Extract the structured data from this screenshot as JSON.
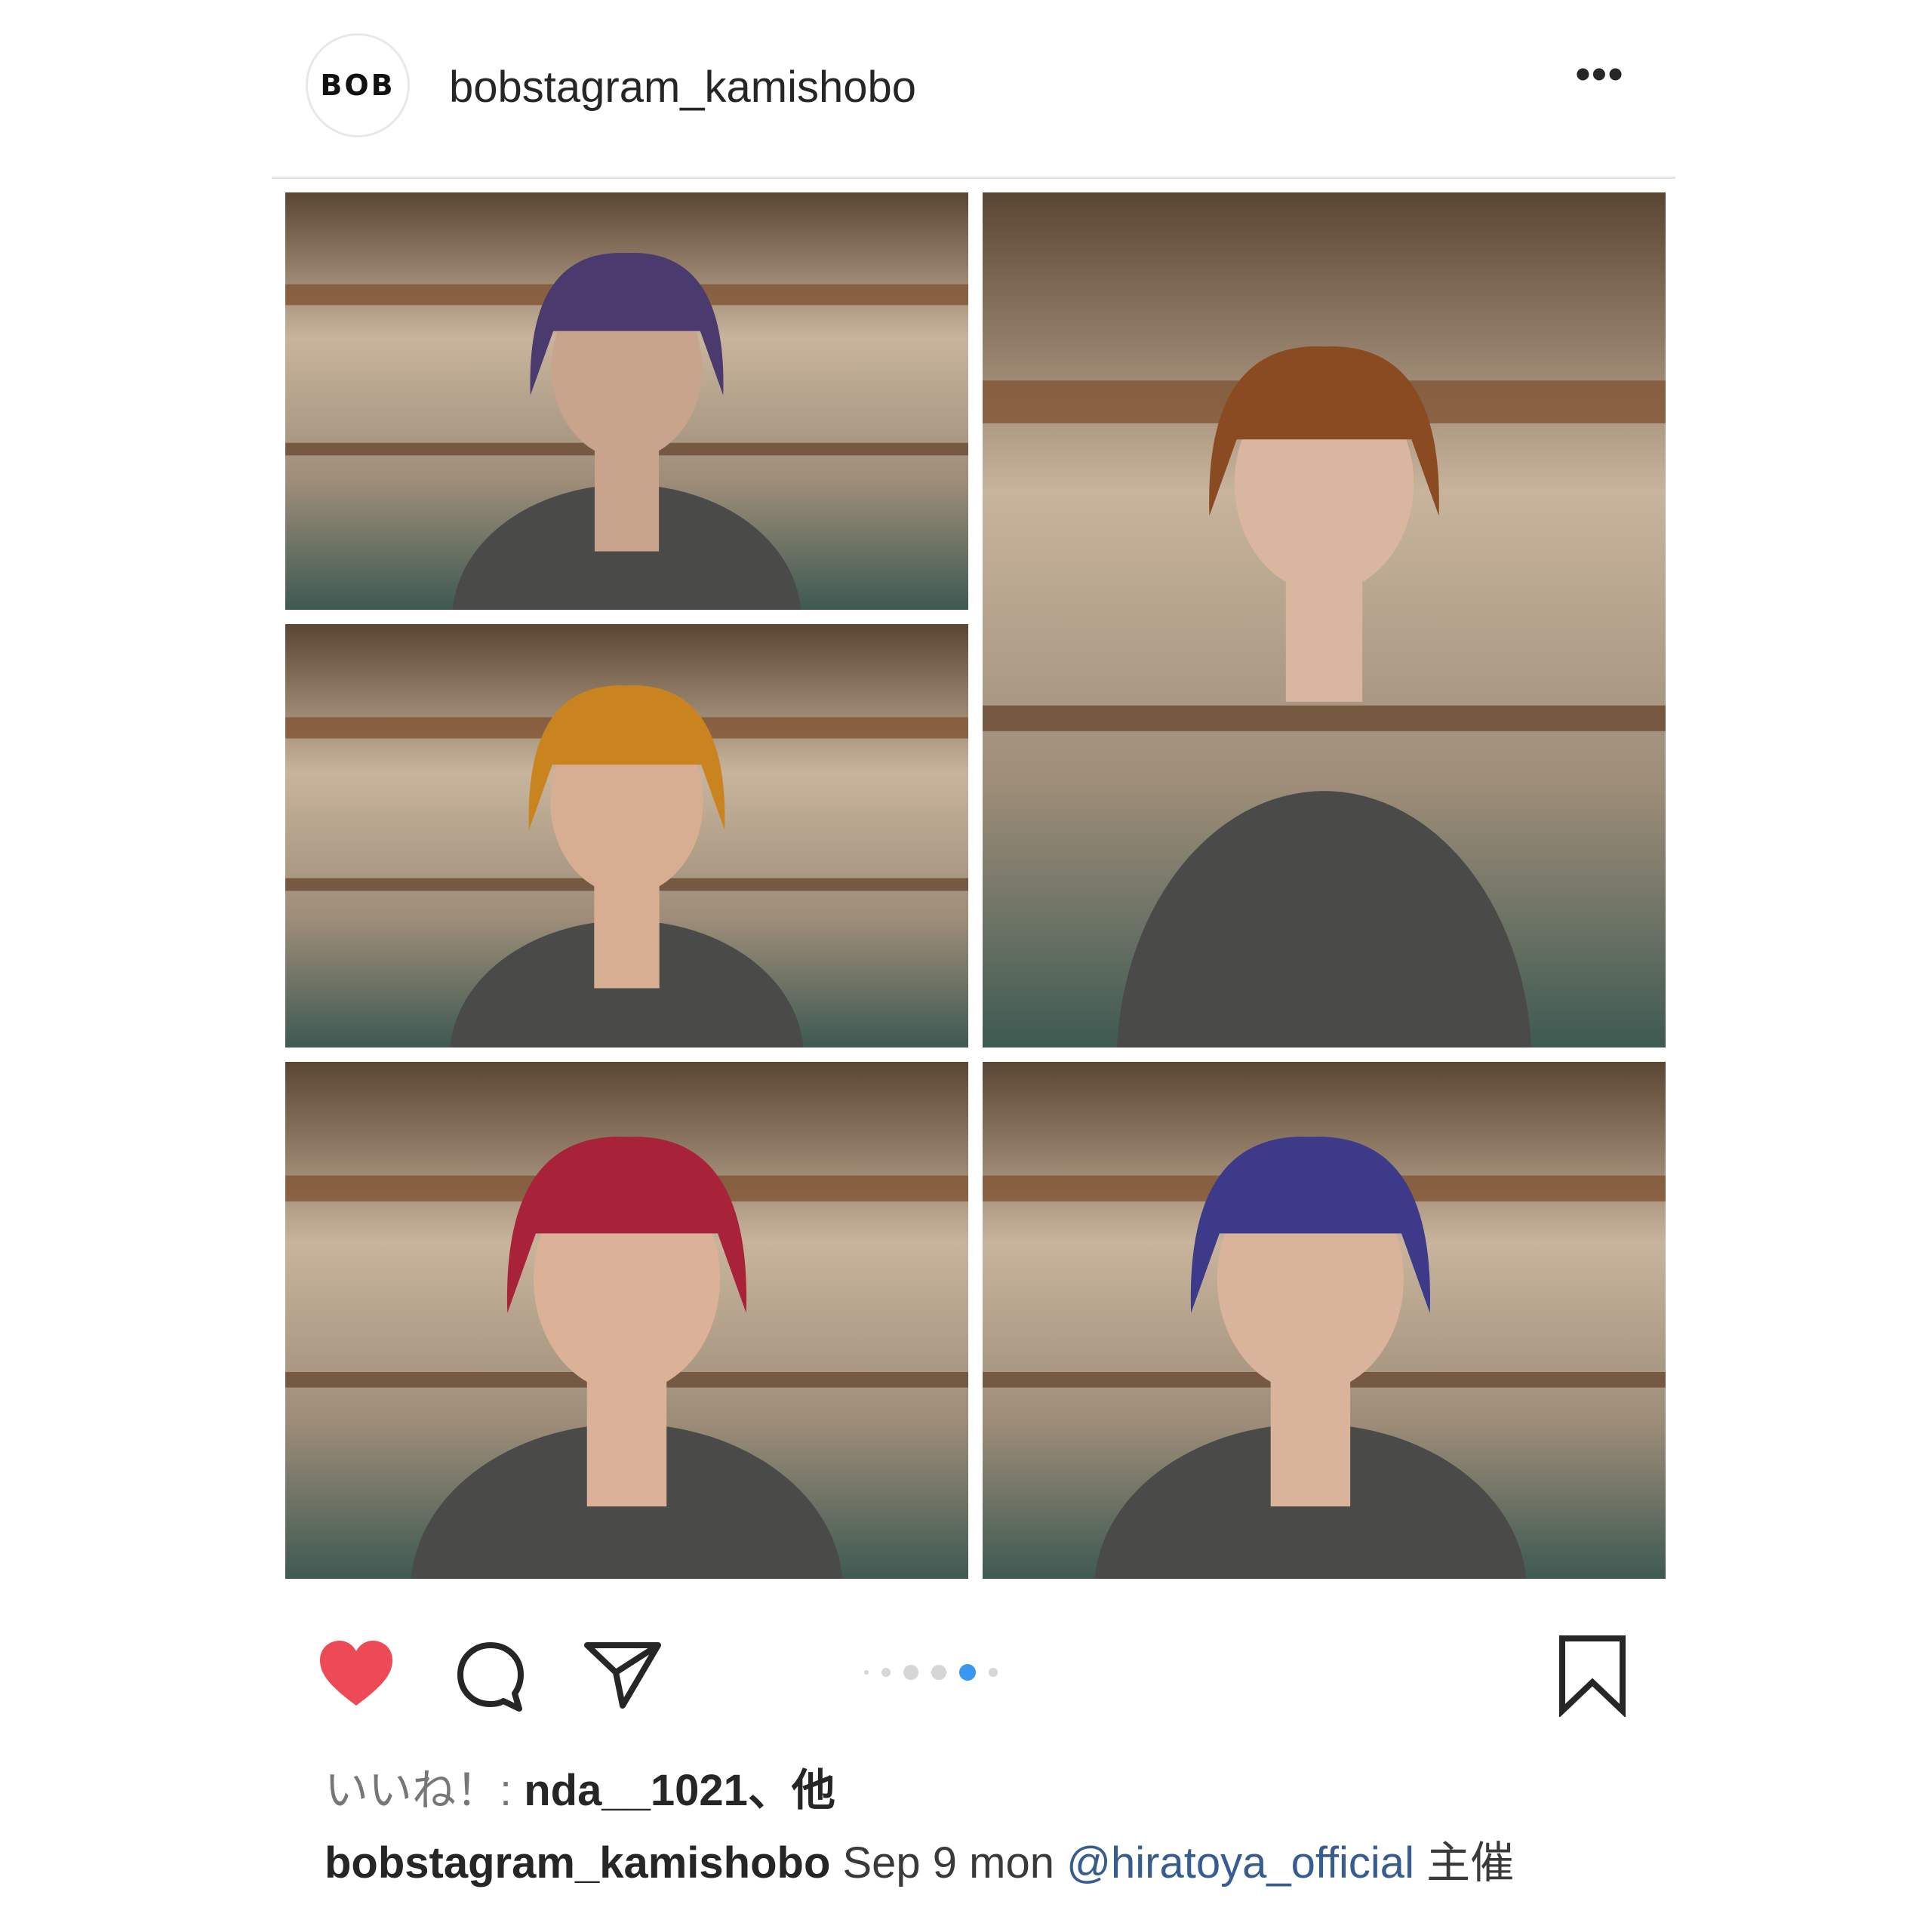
{
  "post": {
    "avatar_text": "BOB",
    "username": "bobstagram_kamishobo",
    "more_label": "•••",
    "images": [
      {
        "name": "photo-top-left",
        "hair": "#4b3a6e",
        "skin": "#c9a48c"
      },
      {
        "name": "photo-right-tall",
        "hair": "#8a4a22",
        "skin": "#d9b6a0"
      },
      {
        "name": "photo-middle-left",
        "hair": "#c98420",
        "skin": "#d7ae92"
      },
      {
        "name": "photo-bottom-left",
        "hair": "#a8233a",
        "skin": "#dbb197"
      },
      {
        "name": "photo-bottom-right",
        "hair": "#3d3a8a",
        "skin": "#d9b39a"
      }
    ],
    "actions": {
      "like_icon": "heart-icon",
      "comment_icon": "comment-icon",
      "share_icon": "paper-plane-icon",
      "save_icon": "bookmark-icon",
      "like_color": "#ed4956"
    },
    "carousel": {
      "count": 6,
      "active_index": 4,
      "accent": "#3897f0"
    },
    "likes": {
      "prefix": "いいね！: ",
      "user": "nda__1021",
      "suffix": "、他"
    },
    "caption": {
      "user": "bobstagram_kamishobo",
      "text": " Sep 9 mon ",
      "mention": "@hiratoya_official",
      "trailing": " 主催"
    }
  }
}
